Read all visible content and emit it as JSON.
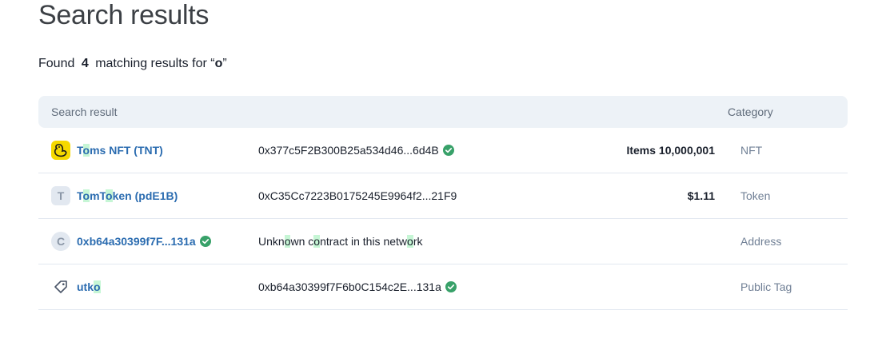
{
  "page": {
    "title": "Search results"
  },
  "summary": {
    "found": "Found",
    "count": "4",
    "middle": "matching results for “",
    "query": "o",
    "end": "”"
  },
  "table": {
    "headers": {
      "result": "Search result",
      "category": "Category"
    },
    "rows": [
      {
        "icon": "duck-token-icon",
        "name_parts": [
          "T",
          "o",
          "ms NFT (TNT)"
        ],
        "address": "0x377c5F2B300B25a534d46...6d4B",
        "verified": true,
        "value": "Items 10,000,001",
        "category": "NFT"
      },
      {
        "icon": "letter-avatar",
        "letter": "T",
        "name_parts": [
          "T",
          "o",
          "mT",
          "o",
          "ken (pdE1B)"
        ],
        "address": "0xC35Cc7223B0175245E9964f2...21F9",
        "verified": false,
        "value": "$1.11",
        "category": "Token"
      },
      {
        "icon": "letter-avatar",
        "letter": "C",
        "name": "0xb64a30399f7F...131a",
        "name_verified": true,
        "address_parts": [
          "Unkn",
          "o",
          "wn c",
          "o",
          "ntract in this netw",
          "o",
          "rk"
        ],
        "value": "",
        "category": "Address"
      },
      {
        "icon": "tag-icon",
        "name_parts": [
          "utk",
          "o"
        ],
        "address": "0xb64a30399f7F6b0C154c2E...131a",
        "verified": true,
        "value": "",
        "category": "Public Tag"
      }
    ]
  },
  "colors": {
    "link": "#2b6cb0",
    "highlight": "#c6f6d5",
    "verified": "#38a169",
    "header_bg": "#edf2f7"
  }
}
